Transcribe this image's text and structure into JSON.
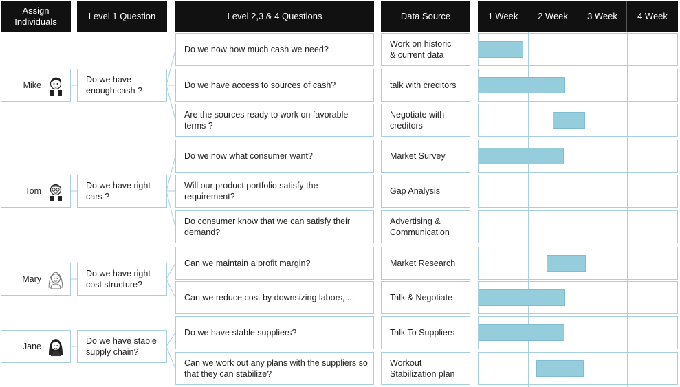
{
  "headers": {
    "assign": "Assign Individuals",
    "level1": "Level 1 Question",
    "level234": "Level 2,3 & 4 Questions",
    "source": "Data Source",
    "weeks": [
      "1 Week",
      "2 Week",
      "3 Week",
      "4 Week"
    ]
  },
  "people": [
    {
      "name": "Mike",
      "icon": "person-icon",
      "question": "Do we have enough cash ?"
    },
    {
      "name": "Tom",
      "icon": "person-glasses-icon",
      "question": "Do we have right cars ?"
    },
    {
      "name": "Mary",
      "icon": "woman-icon",
      "question": "Do we have right cost structure?"
    },
    {
      "name": "Jane",
      "icon": "woman-icon",
      "question": "Do we have stable supply chain?"
    }
  ],
  "rows": [
    {
      "question": "Do we now how much cash we need?",
      "source": "Work on historic & current data",
      "start": 0,
      "end": 0.9
    },
    {
      "question": "Do we have access to sources of cash?",
      "source": "talk with creditors",
      "start": 0,
      "end": 1.75
    },
    {
      "question": "Are the sources ready to work on favorable terms ?",
      "source": "Negotiate with creditors",
      "start": 1.5,
      "end": 2.15
    },
    {
      "question": "Do we now what consumer want?",
      "source": "Market Survey",
      "start": 0,
      "end": 1.72
    },
    {
      "question": "Will our product portfolio satisfy the requirement?",
      "source": "Gap Analysis",
      "start": null,
      "end": null
    },
    {
      "question": "Do consumer know that we can satisfy their demand?",
      "source": "Advertising & Communication",
      "start": null,
      "end": null
    },
    {
      "question": "Can we maintain a profit margin?",
      "source": "Market Research",
      "start": 1.38,
      "end": 2.17
    },
    {
      "question": "Can we reduce cost by downsizing labors, ...",
      "source": "Talk & Negotiate",
      "start": 0,
      "end": 1.75
    },
    {
      "question": "Do we have stable suppliers?",
      "source": "Talk To Suppliers",
      "start": 0,
      "end": 1.74
    },
    {
      "question": "Can we work out any plans with the suppliers so that they can stabilize?",
      "source": "Workout Stabilization plan",
      "start": 1.16,
      "end": 2.12
    }
  ],
  "colors": {
    "header_bg": "#111111",
    "border": "#a8cfe0",
    "bar": "#95cddd",
    "connector": "#a8cfe0"
  }
}
